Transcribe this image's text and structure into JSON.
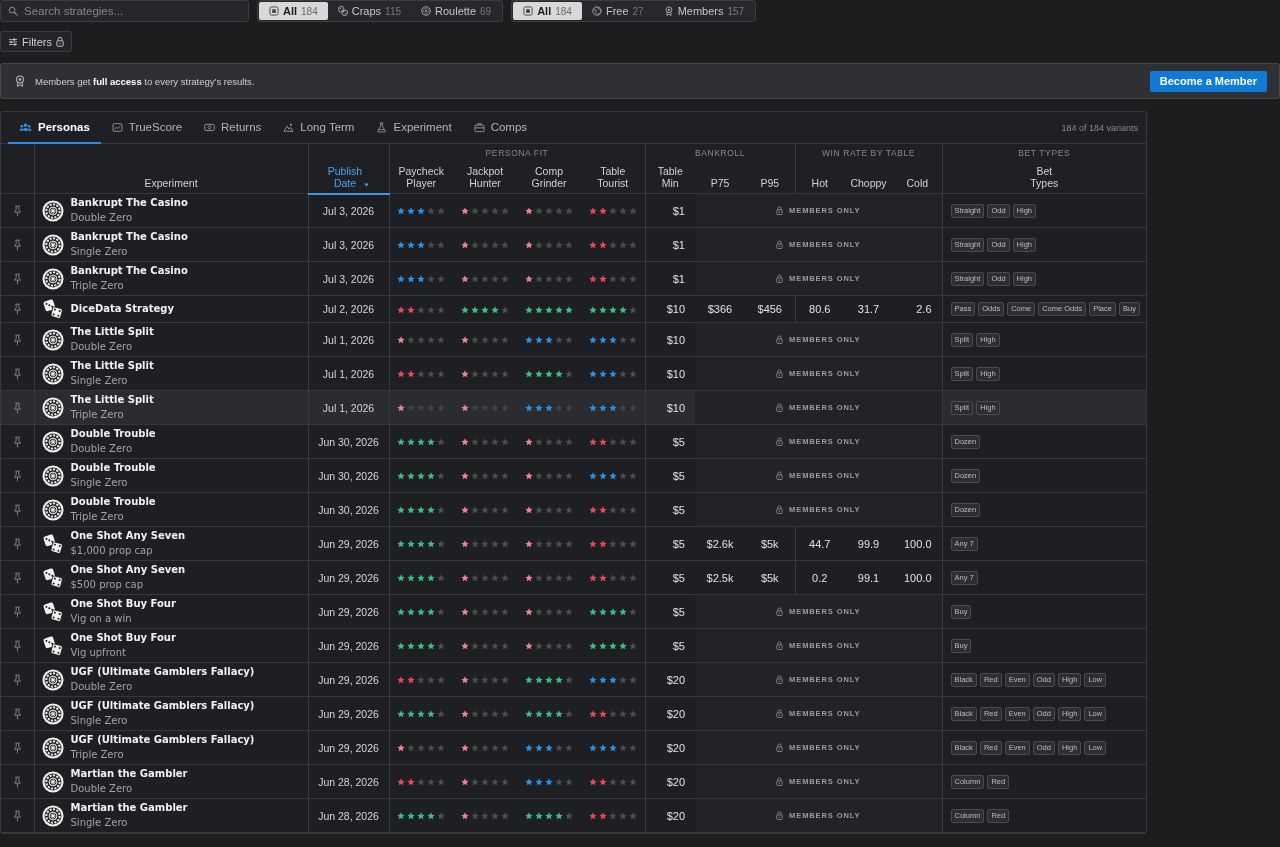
{
  "search": {
    "placeholder": "Search strategies..."
  },
  "game_filter": [
    {
      "kind": "all",
      "label": "All",
      "count": "184",
      "selected": true
    },
    {
      "kind": "craps",
      "label": "Craps",
      "count": "115",
      "selected": false
    },
    {
      "kind": "roulette",
      "label": "Roulette",
      "count": "69",
      "selected": false
    }
  ],
  "access_filter": [
    {
      "kind": "all",
      "label": "All",
      "count": "184",
      "selected": true
    },
    {
      "kind": "free",
      "label": "Free",
      "count": "27",
      "selected": false
    },
    {
      "kind": "members",
      "label": "Members",
      "count": "157",
      "selected": false
    }
  ],
  "filters_button": {
    "label": "Filters",
    "locked": true
  },
  "banner": {
    "text": "Members get **full access** to every strategy’s results.",
    "button": "Become a Member"
  },
  "tabs": [
    {
      "kind": "personas",
      "label": "Personas",
      "selected": true
    },
    {
      "kind": "truescore",
      "label": "TrueScore",
      "selected": false
    },
    {
      "kind": "returns",
      "label": "Returns",
      "selected": false
    },
    {
      "kind": "long_term",
      "label": "Long Term",
      "selected": false
    },
    {
      "kind": "experiment",
      "label": "Experiment",
      "selected": false
    },
    {
      "kind": "comps",
      "label": "Comps",
      "selected": false
    }
  ],
  "variant_count": "184 of 184 variants",
  "table": {
    "experiment_header": "Experiment",
    "date_header": {
      "label": "Publish Date",
      "sorted": true
    },
    "groups": [
      {
        "label": "PERSONA FIT",
        "columns": [
          "Paycheck Player",
          "Jackpot Hunter",
          "Comp Grinder",
          "Table Tourist"
        ]
      },
      {
        "label": "BANKROLL",
        "columns": [
          "Table Min",
          "P75",
          "P95"
        ]
      },
      {
        "label": "WIN RATE BY TABLE",
        "columns": [
          "Hot",
          "Choppy",
          "Cold"
        ]
      },
      {
        "label": "BET TYPES",
        "columns": [
          "Bet Types"
        ]
      }
    ],
    "rows": [
      {
        "kind": "roulette",
        "name": "Bankrupt The Casino",
        "variant": "Double Zero",
        "date": "Jul 3, 2026",
        "persona_fit": [
          {
            "stars": 3
          },
          {
            "stars": 1
          },
          {
            "stars": 1
          },
          {
            "stars": 2
          }
        ],
        "table_min": "$1",
        "results": {
          "kind": "locked",
          "label": "MEMBERS ONLY"
        },
        "bet_types": [
          "Straight",
          "Odd",
          "High"
        ],
        "highlighted": false
      },
      {
        "kind": "roulette",
        "name": "Bankrupt The Casino",
        "variant": "Single Zero",
        "date": "Jul 3, 2026",
        "persona_fit": [
          {
            "stars": 3
          },
          {
            "stars": 1
          },
          {
            "stars": 1
          },
          {
            "stars": 2
          }
        ],
        "table_min": "$1",
        "results": {
          "kind": "locked",
          "label": "MEMBERS ONLY"
        },
        "bet_types": [
          "Straight",
          "Odd",
          "High"
        ],
        "highlighted": false
      },
      {
        "kind": "roulette",
        "name": "Bankrupt The Casino",
        "variant": "Triple Zero",
        "date": "Jul 3, 2026",
        "persona_fit": [
          {
            "stars": 3
          },
          {
            "stars": 1
          },
          {
            "stars": 1
          },
          {
            "stars": 2
          }
        ],
        "table_min": "$1",
        "results": {
          "kind": "locked",
          "label": "MEMBERS ONLY"
        },
        "bet_types": [
          "Straight",
          "Odd",
          "High"
        ],
        "highlighted": false
      },
      {
        "kind": "craps",
        "name": "DiceData Strategy",
        "date": "Jul 2, 2026",
        "persona_fit": [
          {
            "stars": 2
          },
          {
            "stars": 4
          },
          {
            "stars": 5
          },
          {
            "stars": 4
          }
        ],
        "table_min": "$10",
        "results": {
          "kind": "open",
          "p75": "$366",
          "p95": "$456",
          "hot": "80.6",
          "choppy": "31.7",
          "cold": "2.6"
        },
        "bet_types": [
          "Pass",
          "Odds",
          "Come",
          "Come Odds",
          "Place",
          "Buy"
        ],
        "highlighted": false
      },
      {
        "kind": "roulette",
        "name": "The Little Split",
        "variant": "Double Zero",
        "date": "Jul 1, 2026",
        "persona_fit": [
          {
            "stars": 1
          },
          {
            "stars": 1
          },
          {
            "stars": 3
          },
          {
            "stars": 3
          }
        ],
        "table_min": "$10",
        "results": {
          "kind": "locked",
          "label": "MEMBERS ONLY"
        },
        "bet_types": [
          "Split",
          "High"
        ],
        "highlighted": false
      },
      {
        "kind": "roulette",
        "name": "The Little Split",
        "variant": "Single Zero",
        "date": "Jul 1, 2026",
        "persona_fit": [
          {
            "stars": 2
          },
          {
            "stars": 1
          },
          {
            "stars": 4
          },
          {
            "stars": 3
          }
        ],
        "table_min": "$10",
        "results": {
          "kind": "locked",
          "label": "MEMBERS ONLY"
        },
        "bet_types": [
          "Split",
          "High"
        ],
        "highlighted": false
      },
      {
        "kind": "roulette",
        "name": "The Little Split",
        "variant": "Triple Zero",
        "date": "Jul 1, 2026",
        "persona_fit": [
          {
            "stars": 1
          },
          {
            "stars": 1
          },
          {
            "stars": 3
          },
          {
            "stars": 3
          }
        ],
        "table_min": "$10",
        "results": {
          "kind": "locked",
          "label": "MEMBERS ONLY"
        },
        "bet_types": [
          "Split",
          "High"
        ],
        "highlighted": true
      },
      {
        "kind": "roulette",
        "name": "Double Trouble",
        "variant": "Double Zero",
        "date": "Jun 30, 2026",
        "persona_fit": [
          {
            "stars": 4
          },
          {
            "stars": 1
          },
          {
            "stars": 1
          },
          {
            "stars": 2
          }
        ],
        "table_min": "$5",
        "results": {
          "kind": "locked",
          "label": "MEMBERS ONLY"
        },
        "bet_types": [
          "Dozen"
        ],
        "highlighted": false
      },
      {
        "kind": "roulette",
        "name": "Double Trouble",
        "variant": "Single Zero",
        "date": "Jun 30, 2026",
        "persona_fit": [
          {
            "stars": 4
          },
          {
            "stars": 1
          },
          {
            "stars": 1
          },
          {
            "stars": 3
          }
        ],
        "table_min": "$5",
        "results": {
          "kind": "locked",
          "label": "MEMBERS ONLY"
        },
        "bet_types": [
          "Dozen"
        ],
        "highlighted": false
      },
      {
        "kind": "roulette",
        "name": "Double Trouble",
        "variant": "Triple Zero",
        "date": "Jun 30, 2026",
        "persona_fit": [
          {
            "stars": 4
          },
          {
            "stars": 1
          },
          {
            "stars": 1
          },
          {
            "stars": 2
          }
        ],
        "table_min": "$5",
        "results": {
          "kind": "locked",
          "label": "MEMBERS ONLY"
        },
        "bet_types": [
          "Dozen"
        ],
        "highlighted": false
      },
      {
        "kind": "craps",
        "name": "One Shot Any Seven",
        "variant": "$1,000 prop cap",
        "date": "Jun 29, 2026",
        "persona_fit": [
          {
            "stars": 4
          },
          {
            "stars": 1
          },
          {
            "stars": 1
          },
          {
            "stars": 2
          }
        ],
        "table_min": "$5",
        "results": {
          "kind": "open",
          "p75": "$2.6k",
          "p95": "$5k",
          "hot": "44.7",
          "choppy": "99.9",
          "cold": "100.0"
        },
        "bet_types": [
          "Any 7"
        ],
        "highlighted": false
      },
      {
        "kind": "craps",
        "name": "One Shot Any Seven",
        "variant": "$500 prop cap",
        "date": "Jun 29, 2026",
        "persona_fit": [
          {
            "stars": 4
          },
          {
            "stars": 1
          },
          {
            "stars": 1
          },
          {
            "stars": 2
          }
        ],
        "table_min": "$5",
        "results": {
          "kind": "open",
          "p75": "$2.5k",
          "p95": "$5k",
          "hot": "0.2",
          "choppy": "99.1",
          "cold": "100.0"
        },
        "bet_types": [
          "Any 7"
        ],
        "highlighted": false
      },
      {
        "kind": "craps",
        "name": "One Shot Buy Four",
        "variant": "Vig on a win",
        "date": "Jun 29, 2026",
        "persona_fit": [
          {
            "stars": 4
          },
          {
            "stars": 1
          },
          {
            "stars": 1
          },
          {
            "stars": 4
          }
        ],
        "table_min": "$5",
        "results": {
          "kind": "locked",
          "label": "MEMBERS ONLY"
        },
        "bet_types": [
          "Buy"
        ],
        "highlighted": false
      },
      {
        "kind": "craps",
        "name": "One Shot Buy Four",
        "variant": "Vig upfront",
        "date": "Jun 29, 2026",
        "persona_fit": [
          {
            "stars": 4
          },
          {
            "stars": 1
          },
          {
            "stars": 1
          },
          {
            "stars": 4
          }
        ],
        "table_min": "$5",
        "results": {
          "kind": "locked",
          "label": "MEMBERS ONLY"
        },
        "bet_types": [
          "Buy"
        ],
        "highlighted": false
      },
      {
        "kind": "roulette",
        "name": "UGF (Ultimate Gamblers Fallacy)",
        "variant": "Double Zero",
        "date": "Jun 29, 2026",
        "persona_fit": [
          {
            "stars": 2
          },
          {
            "stars": 1
          },
          {
            "stars": 4
          },
          {
            "stars": 3
          }
        ],
        "table_min": "$20",
        "results": {
          "kind": "locked",
          "label": "MEMBERS ONLY"
        },
        "bet_types": [
          "Black",
          "Red",
          "Even",
          "Odd",
          "High",
          "Low"
        ],
        "highlighted": false
      },
      {
        "kind": "roulette",
        "name": "UGF (Ultimate Gamblers Fallacy)",
        "variant": "Single Zero",
        "date": "Jun 29, 2026",
        "persona_fit": [
          {
            "stars": 4
          },
          {
            "stars": 1
          },
          {
            "stars": 4
          },
          {
            "stars": 2
          }
        ],
        "table_min": "$20",
        "results": {
          "kind": "locked",
          "label": "MEMBERS ONLY"
        },
        "bet_types": [
          "Black",
          "Red",
          "Even",
          "Odd",
          "High",
          "Low"
        ],
        "highlighted": false
      },
      {
        "kind": "roulette",
        "name": "UGF (Ultimate Gamblers Fallacy)",
        "variant": "Triple Zero",
        "date": "Jun 29, 2026",
        "persona_fit": [
          {
            "stars": 1
          },
          {
            "stars": 1
          },
          {
            "stars": 3
          },
          {
            "stars": 3
          }
        ],
        "table_min": "$20",
        "results": {
          "kind": "locked",
          "label": "MEMBERS ONLY"
        },
        "bet_types": [
          "Black",
          "Red",
          "Even",
          "Odd",
          "High",
          "Low"
        ],
        "highlighted": false
      },
      {
        "kind": "roulette",
        "name": "Martian the Gambler",
        "variant": "Double Zero",
        "date": "Jun 28, 2026",
        "persona_fit": [
          {
            "stars": 2
          },
          {
            "stars": 1
          },
          {
            "stars": 3
          },
          {
            "stars": 2
          }
        ],
        "table_min": "$20",
        "results": {
          "kind": "locked",
          "label": "MEMBERS ONLY"
        },
        "bet_types": [
          "Column",
          "Red"
        ],
        "highlighted": false
      },
      {
        "kind": "roulette",
        "name": "Martian the Gambler",
        "variant": "Single Zero",
        "date": "Jun 28, 2026",
        "persona_fit": [
          {
            "stars": 4
          },
          {
            "stars": 1
          },
          {
            "stars": 4
          },
          {
            "stars": 2
          }
        ],
        "table_min": "$20",
        "results": {
          "kind": "locked",
          "label": "MEMBERS ONLY"
        },
        "bet_types": [
          "Column",
          "Red"
        ],
        "highlighted": false
      }
    ]
  }
}
